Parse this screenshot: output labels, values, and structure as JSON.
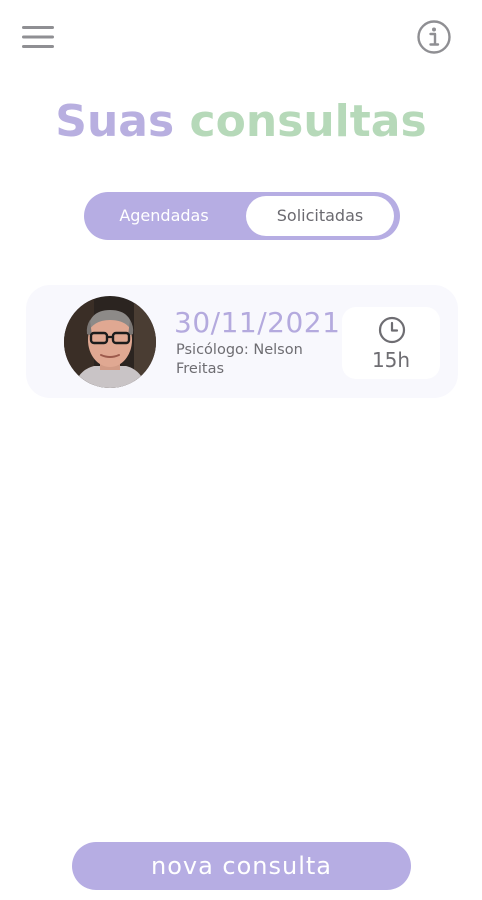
{
  "header": {
    "menu_icon": "hamburger-menu-icon",
    "info_icon": "info-icon"
  },
  "title": {
    "part1": "Suas",
    "part2": "consultas"
  },
  "tabs": [
    {
      "label": "Agendadas",
      "selected": false
    },
    {
      "label": "Solicitadas",
      "selected": true
    }
  ],
  "appointments": [
    {
      "date": "30/11/2021",
      "description": "Psicólogo: Nelson Freitas",
      "time": "15h",
      "time_icon": "clock-icon",
      "avatar_icon": "doctor-avatar"
    }
  ],
  "footer": {
    "new_button_label": "nova consulta"
  },
  "colors": {
    "purple": "#b6ade3",
    "green": "#b6d9b9",
    "text_gray": "#6e6d72"
  }
}
